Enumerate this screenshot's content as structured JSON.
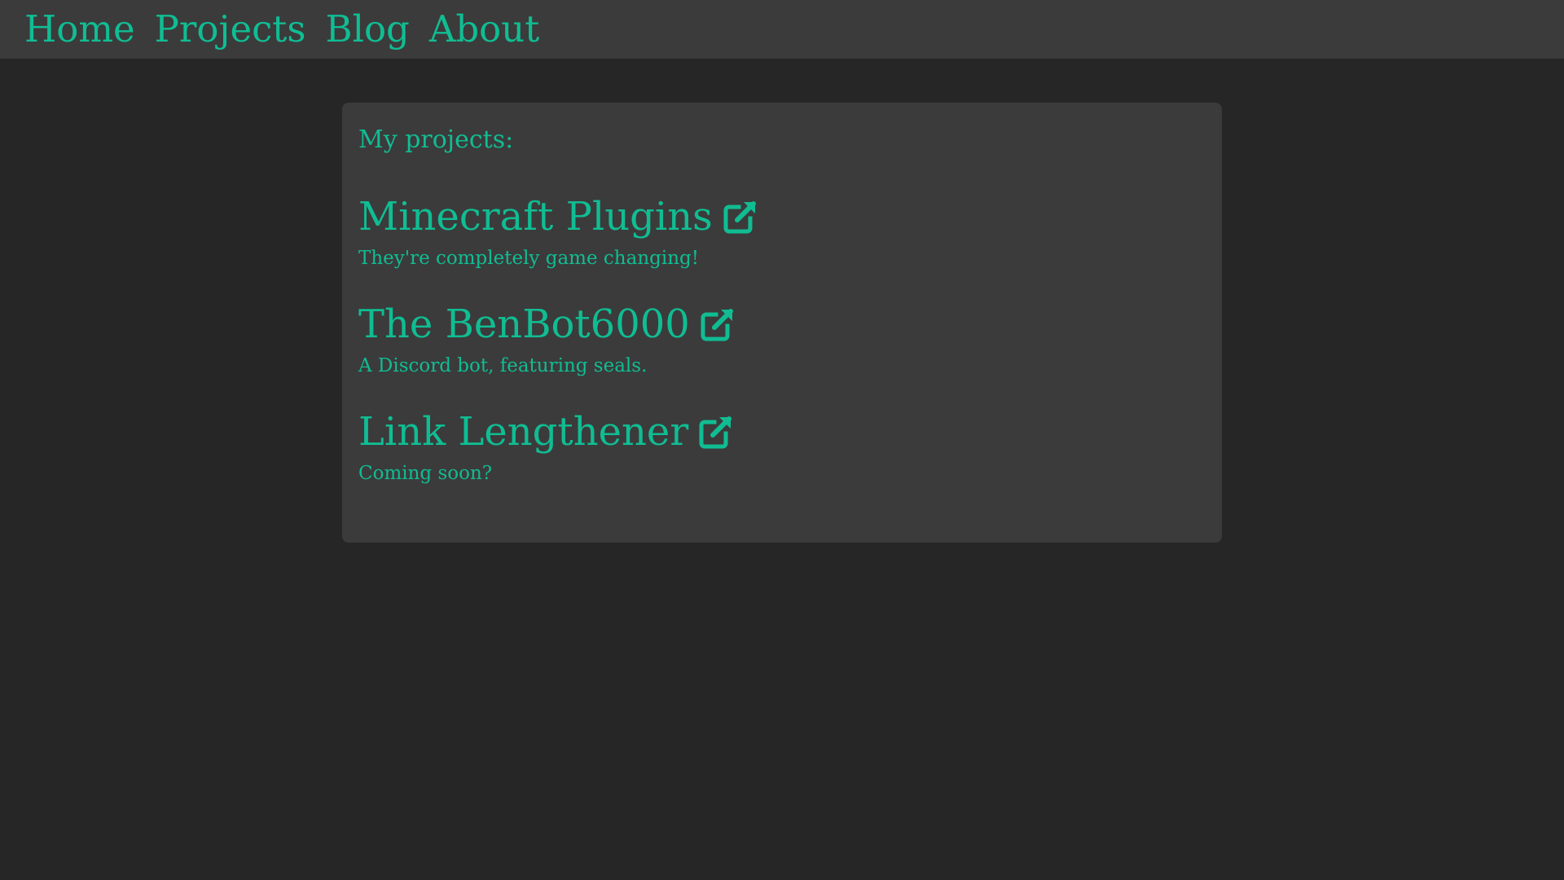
{
  "nav": {
    "items": [
      {
        "label": "Home"
      },
      {
        "label": "Projects"
      },
      {
        "label": "Blog"
      },
      {
        "label": "About"
      }
    ]
  },
  "main": {
    "heading": "My projects:",
    "projects": [
      {
        "title": "Minecraft Plugins",
        "description": "They're completely game changing!",
        "icon": "external-link-icon"
      },
      {
        "title": "The BenBot6000",
        "description": "A Discord bot, featuring seals.",
        "icon": "external-link-icon"
      },
      {
        "title": "Link Lengthener",
        "description": "Coming soon?",
        "icon": "external-link-icon"
      }
    ]
  },
  "colors": {
    "background": "#262626",
    "panel": "#3b3b3b",
    "accent": "#10bd93"
  }
}
